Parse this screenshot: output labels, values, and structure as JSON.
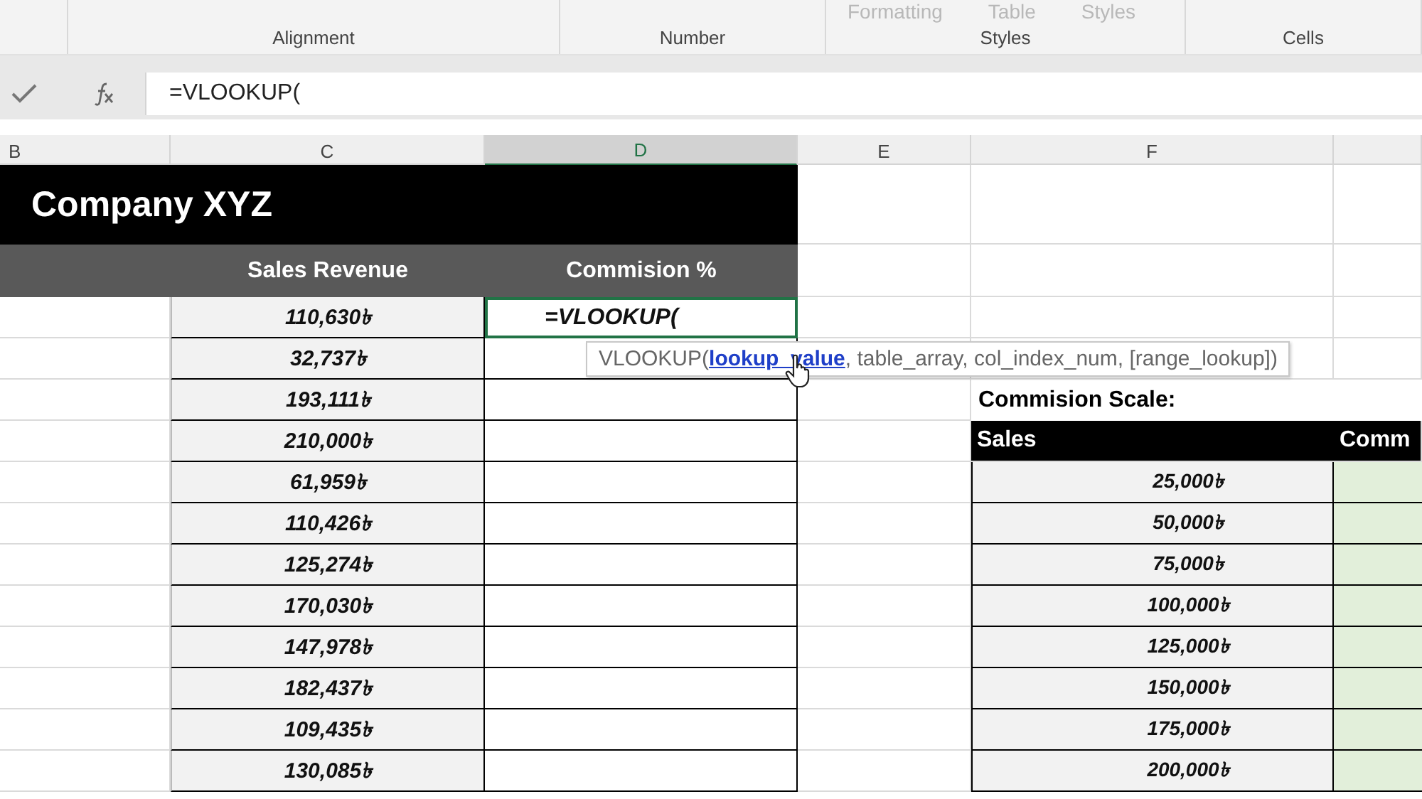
{
  "ribbon": {
    "cut_labels": [
      "Formatting",
      "Table",
      "Styles"
    ],
    "groups": [
      {
        "label": "Alignment"
      },
      {
        "label": "Number"
      },
      {
        "label": "Styles"
      },
      {
        "label": "Cells"
      }
    ]
  },
  "formula_bar": {
    "formula": "=VLOOKUP("
  },
  "columns": [
    {
      "label": "B",
      "selected": false
    },
    {
      "label": "C",
      "selected": false
    },
    {
      "label": "D",
      "selected": true
    },
    {
      "label": "E",
      "selected": false
    },
    {
      "label": "F",
      "selected": false
    }
  ],
  "title": "Company XYZ",
  "headers": [
    "Sales Revenue",
    "Commision %"
  ],
  "rows": [
    {
      "sales": "110,630৳",
      "commission": "=VLOOKUP(",
      "selected": true
    },
    {
      "sales": "32,737৳",
      "selected": false
    },
    {
      "sales": "193,111৳",
      "selected": false
    },
    {
      "sales": "210,000৳",
      "selected": false
    },
    {
      "sales": "61,959৳",
      "selected": false
    },
    {
      "sales": "110,426৳",
      "selected": false
    },
    {
      "sales": "125,274৳",
      "selected": false
    },
    {
      "sales": "170,030৳",
      "selected": false
    },
    {
      "sales": "147,978৳",
      "selected": false
    },
    {
      "sales": "182,437৳",
      "selected": false
    },
    {
      "sales": "109,435৳",
      "selected": false
    },
    {
      "sales": "130,085৳",
      "selected": false
    }
  ],
  "tooltip": {
    "function": "VLOOKUP(",
    "current_arg": "lookup_value",
    "rest": ", table_array, col_index_num, [range_lookup])"
  },
  "scale": {
    "title": "Commision Scale:",
    "headers": [
      "Sales",
      "Comm"
    ],
    "values": [
      "25,000৳",
      "50,000৳",
      "75,000৳",
      "100,000৳",
      "125,000৳",
      "150,000৳",
      "175,000৳",
      "200,000৳"
    ]
  }
}
